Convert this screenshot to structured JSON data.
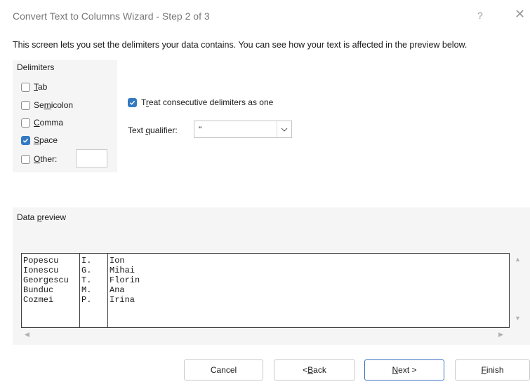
{
  "window": {
    "title": "Convert Text to Columns Wizard - Step 2 of 3",
    "help_label": "?",
    "close_label": "✕"
  },
  "description": "This screen lets you set the delimiters your data contains.  You can see how your text is affected in the preview below.",
  "delimiters": {
    "group_label": "Delimiters",
    "tab": {
      "label": "Tab",
      "checked": false
    },
    "semicolon": {
      "label": "Semicolon",
      "checked": false
    },
    "comma": {
      "label": "Comma",
      "checked": false
    },
    "space": {
      "label": "Space",
      "checked": true
    },
    "other": {
      "label": "Other:",
      "checked": false,
      "value": ""
    }
  },
  "options": {
    "treat_consecutive": {
      "label": "Treat consecutive delimiters as one",
      "checked": true
    },
    "text_qualifier_label": "Text qualifier:",
    "text_qualifier_value": "\""
  },
  "preview": {
    "label": "Data preview",
    "rows": [
      [
        "Popescu",
        "I.",
        "Ion"
      ],
      [
        "Ionescu",
        "G.",
        "Mihai"
      ],
      [
        "Georgescu",
        "T.",
        "Florin"
      ],
      [
        "Bunduc",
        "M.",
        "Ana"
      ],
      [
        "Cozmei",
        "P.",
        "Irina"
      ]
    ]
  },
  "buttons": {
    "cancel": "Cancel",
    "back": "< Back",
    "next": "Next >",
    "finish": "Finish"
  },
  "colors": {
    "accent": "#3479c3",
    "panel_bg": "#f5f5f5"
  }
}
